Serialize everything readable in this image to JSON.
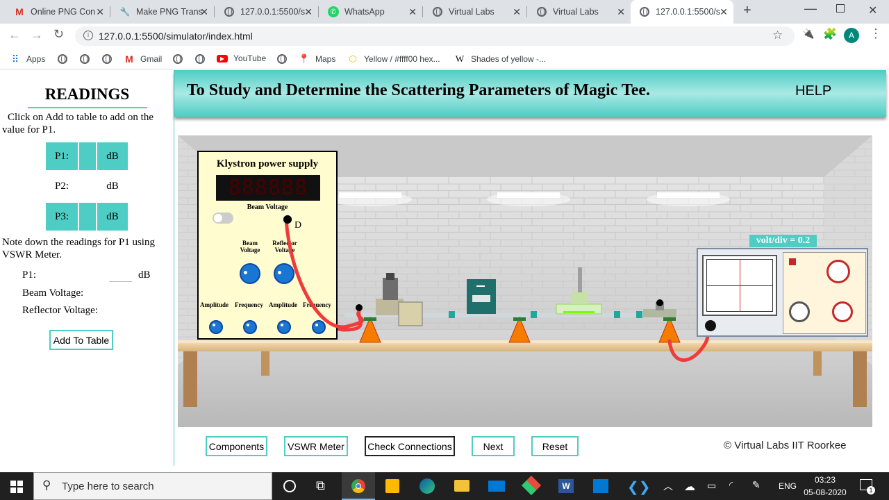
{
  "browser": {
    "tabs": [
      {
        "label": "Online PNG Con",
        "icon": "gmail-icon"
      },
      {
        "label": "Make PNG Trans",
        "icon": "wrench-icon"
      },
      {
        "label": "127.0.0.1:5500/s",
        "icon": "globe-icon"
      },
      {
        "label": "WhatsApp",
        "icon": "whatsapp-icon"
      },
      {
        "label": "Virtual Labs",
        "icon": "globe-icon"
      },
      {
        "label": "Virtual Labs",
        "icon": "globe-icon"
      },
      {
        "label": "127.0.0.1:5500/s",
        "icon": "globe-icon",
        "active": true
      }
    ],
    "url": "127.0.0.1:5500/simulator/index.html",
    "profile_initial": "A",
    "bookmarks": [
      {
        "label": "Apps",
        "icon": "apps-icon"
      },
      {
        "label": "",
        "icon": "globe-icon"
      },
      {
        "label": "",
        "icon": "globe-icon"
      },
      {
        "label": "",
        "icon": "globe-icon"
      },
      {
        "label": "Gmail",
        "icon": "gmail-icon"
      },
      {
        "label": "",
        "icon": "globe-icon"
      },
      {
        "label": "",
        "icon": "globe-icon"
      },
      {
        "label": "YouTube",
        "icon": "youtube-icon"
      },
      {
        "label": "",
        "icon": "globe-icon"
      },
      {
        "label": "Maps",
        "icon": "maps-icon"
      },
      {
        "label": "Yellow / #ffff00 hex...",
        "icon": "hex-icon"
      },
      {
        "label": "Shades of yellow -...",
        "icon": "wikipedia-icon"
      }
    ]
  },
  "sidebar": {
    "title": "READINGS",
    "instruction": "Click on Add to table to add on the value for P1.",
    "table": [
      {
        "label": "P1:",
        "value": "",
        "unit": "dB"
      },
      {
        "label": "P2:",
        "value": "",
        "unit": "dB"
      },
      {
        "label": "P3:",
        "value": "",
        "unit": "dB"
      }
    ],
    "note": "Note down the readings for P1 using VSWR Meter.",
    "p1_label": "P1:",
    "p1_value": "",
    "p1_unit": "dB",
    "beam_voltage_label": "Beam Voltage:",
    "reflector_voltage_label": "Reflector Voltage:",
    "add_button": "Add To Table"
  },
  "header": {
    "title": "To Study and Determine the Scattering Parameters of Magic Tee.",
    "help": "HELP"
  },
  "klystron": {
    "title": "Klystron power supply",
    "display": "888888",
    "beam_voltage_label": "Beam Voltage",
    "terminal_label": "D",
    "knob_labels": [
      "Beam Voltage",
      "Reflector Voltage"
    ],
    "bottom_labels": [
      "Amplitude",
      "Frequency",
      "Amplitude",
      "Frequency"
    ]
  },
  "oscilloscope": {
    "volt_div": "volt/div = 0.2"
  },
  "buttons": {
    "components": "Components",
    "vswr": "VSWR Meter",
    "check": "Check Connections",
    "next": "Next",
    "reset": "Reset"
  },
  "footer": {
    "copyright": "© Virtual Labs IIT Roorkee"
  },
  "taskbar": {
    "search_placeholder": "Type here to search",
    "language": "ENG",
    "time": "03:23",
    "date": "05-08-2020",
    "notification_count": "1"
  },
  "colors": {
    "teal": "#4ecdc4",
    "panel": "#fffdcf",
    "cable": "#ef3b3b",
    "knob": "#1976d2"
  }
}
